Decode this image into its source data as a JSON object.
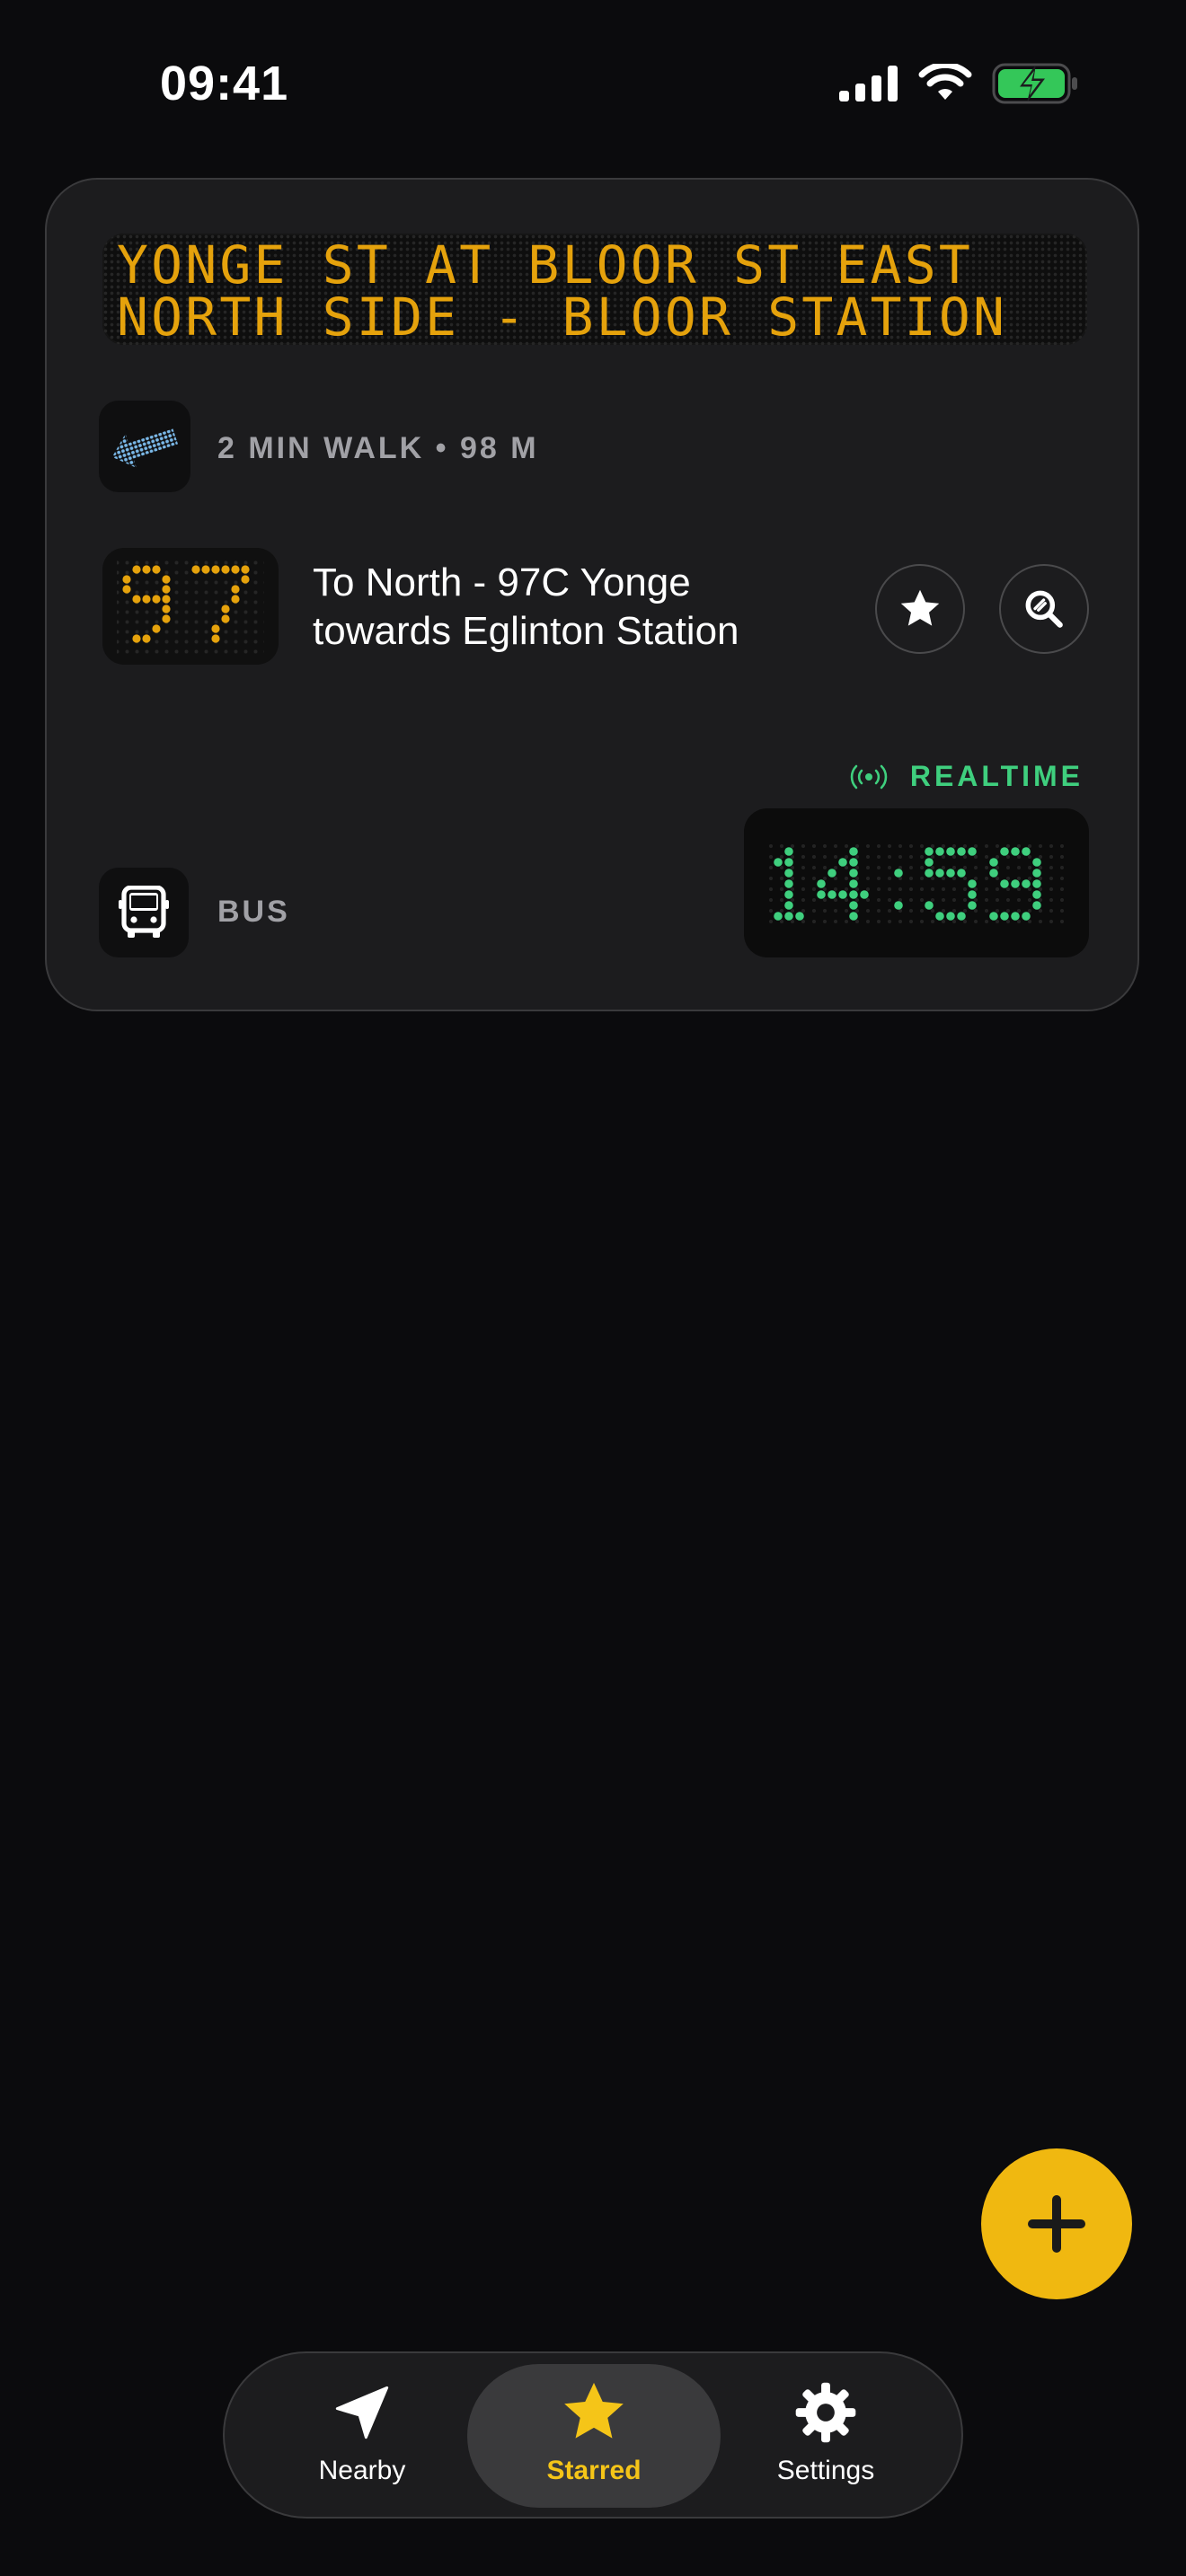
{
  "status_bar": {
    "time": "09:41"
  },
  "stop": {
    "sign_lines": [
      "YONGE ST AT BLOOR ST EAST",
      "NORTH SIDE - BLOOR STATION"
    ],
    "walk": "2 MIN WALK • 98 M",
    "route_number": "97",
    "route_description": "To North - 97C Yonge towards Eglinton Station",
    "realtime_label": "REALTIME",
    "arrival_time": "14:59",
    "mode_label": "BUS"
  },
  "tabs": [
    {
      "label": "Nearby",
      "icon": "location-arrow-icon"
    },
    {
      "label": "Starred",
      "icon": "star-icon",
      "active": true
    },
    {
      "label": "Settings",
      "icon": "gear-icon"
    }
  ],
  "colors": {
    "led_amber": "#e5a20c",
    "realtime_green": "#3fcf7e",
    "accent_yellow": "#f0b810",
    "walk_arrow_blue": "#7ab8e8"
  }
}
